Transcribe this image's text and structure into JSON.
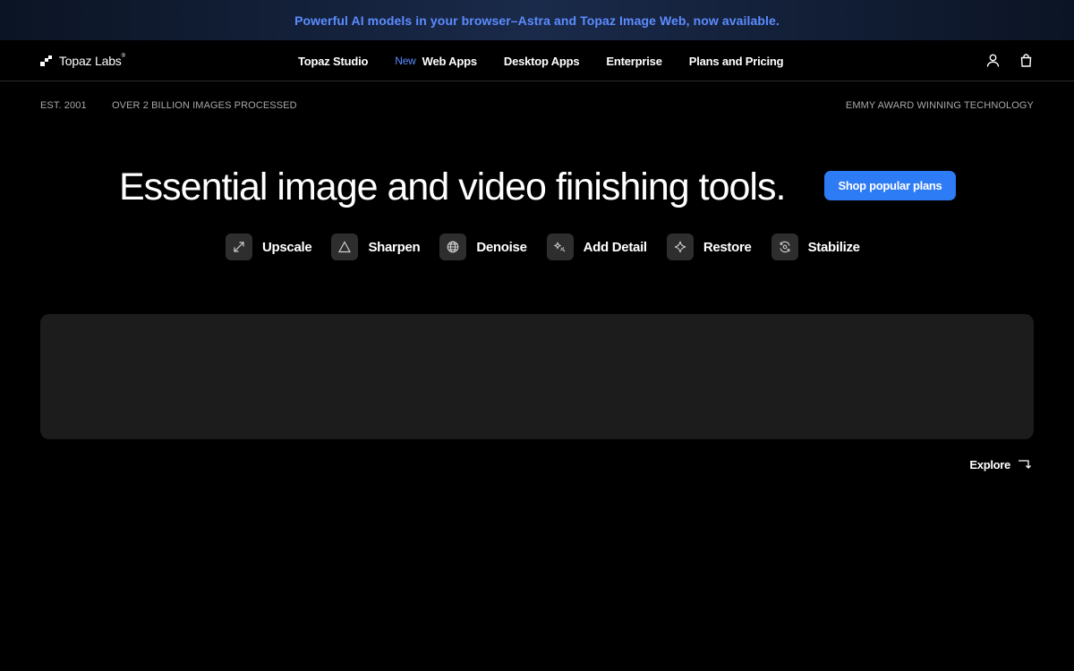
{
  "announcement": {
    "text": "Powerful AI models in your browser–Astra and Topaz Image Web, now available."
  },
  "brand": {
    "name": "Topaz Labs",
    "registered": "®"
  },
  "nav": {
    "items": [
      {
        "label": "Topaz Studio",
        "badge": ""
      },
      {
        "label": "Web Apps",
        "badge": "New"
      },
      {
        "label": "Desktop Apps",
        "badge": ""
      },
      {
        "label": "Enterprise",
        "badge": ""
      },
      {
        "label": "Plans and Pricing",
        "badge": ""
      }
    ],
    "icons": [
      "user-icon",
      "shopping-bag-icon"
    ]
  },
  "stats": {
    "established": "EST. 2001",
    "processed": "OVER 2 BILLION IMAGES PROCESSED",
    "award": "EMMY AWARD WINNING TECHNOLOGY"
  },
  "hero": {
    "title": "Essential image and video finishing tools.",
    "cta_label": "Shop popular plans"
  },
  "features": [
    {
      "label": "Upscale",
      "icon": "expand-icon"
    },
    {
      "label": "Sharpen",
      "icon": "triangle-icon"
    },
    {
      "label": "Denoise",
      "icon": "globe-icon"
    },
    {
      "label": "Add Detail",
      "icon": "sparkle-detail-icon"
    },
    {
      "label": "Restore",
      "icon": "star-sparkle-icon"
    },
    {
      "label": "Stabilize",
      "icon": "stabilize-icon"
    }
  ],
  "explore": {
    "label": "Explore"
  },
  "colors": {
    "background": "#000000",
    "accent": "#2e7bf6",
    "announcement_text": "#5b8cff",
    "panel": "#1c1c1c",
    "feature_icon_bg": "#2e2e2e"
  }
}
